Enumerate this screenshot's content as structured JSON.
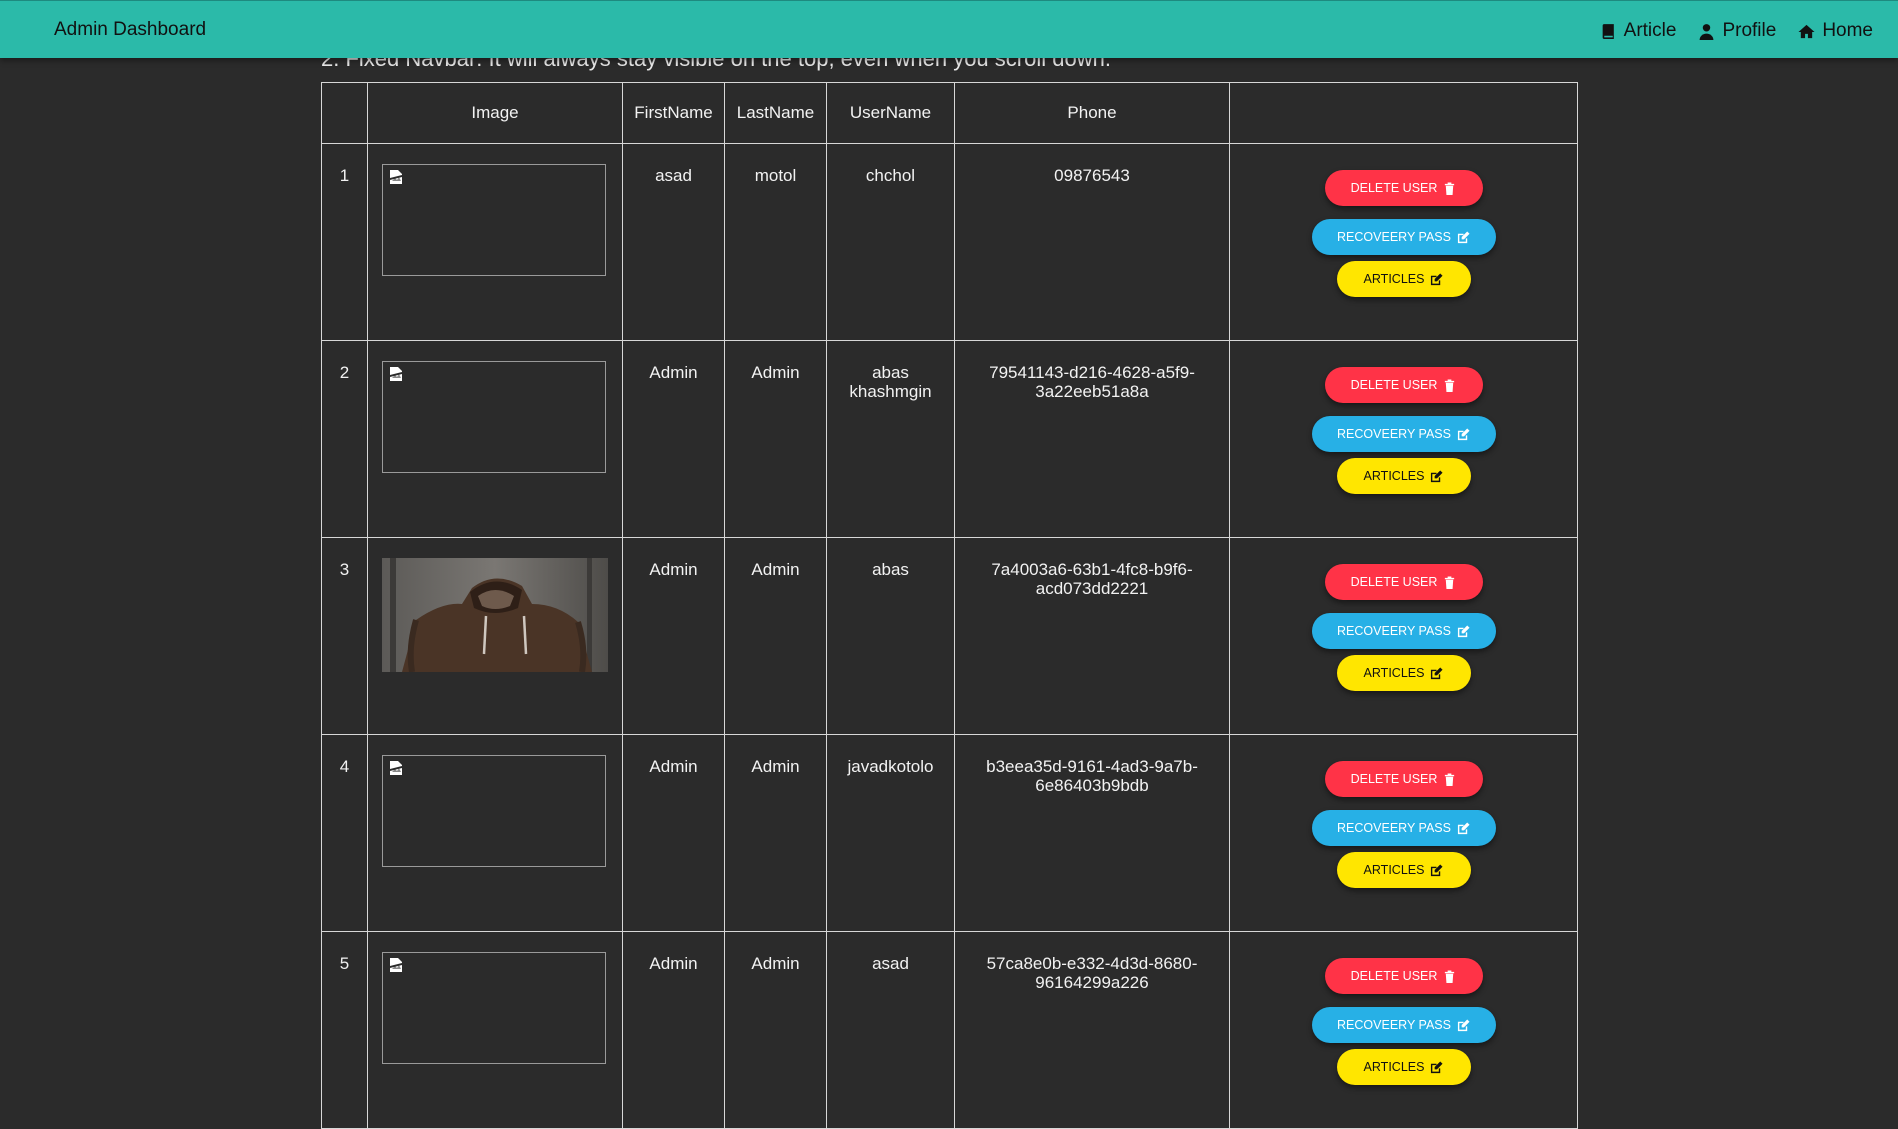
{
  "navbar": {
    "brand": "Admin Dashboard",
    "links": [
      {
        "label": "Article",
        "icon": "book-icon"
      },
      {
        "label": "Profile",
        "icon": "user-icon"
      },
      {
        "label": "Home",
        "icon": "home-icon"
      }
    ]
  },
  "intro_text": "2. Fixed Navbar: It will always stay visible on the top, even when you scroll down.",
  "table": {
    "headers": [
      "",
      "Image",
      "FirstName",
      "LastName",
      "UserName",
      "Phone",
      ""
    ],
    "rows": [
      {
        "index": "1",
        "first": "asad",
        "last": "motol",
        "username": "chchol",
        "phone": "09876543",
        "image": "broken-image"
      },
      {
        "index": "2",
        "first": "Admin",
        "last": "Admin",
        "username": "abas khashmgin",
        "phone": "79541143-d216-4628-a5f9-3a22eeb51a8a",
        "image": "broken-image"
      },
      {
        "index": "3",
        "first": "Admin",
        "last": "Admin",
        "username": "abas",
        "phone": "7a4003a6-63b1-4fc8-b9f6-acd073dd2221",
        "image": "photo-hooded-person"
      },
      {
        "index": "4",
        "first": "Admin",
        "last": "Admin",
        "username": "javadkotolo",
        "phone": "b3eea35d-9161-4ad3-9a7b-6e86403b9bdb",
        "image": "broken-image"
      },
      {
        "index": "5",
        "first": "Admin",
        "last": "Admin",
        "username": "asad",
        "phone": "57ca8e0b-e332-4d3d-8680-96164299a226",
        "image": "broken-image"
      }
    ]
  },
  "actions": {
    "delete_label": "DELETE USER",
    "recover_label": "RECOVEERY PASS",
    "articles_label": "ARTICLES"
  },
  "colors": {
    "navbar": "#2bbaa9",
    "background": "#2b2b2b",
    "delete": "#ff3347",
    "recover": "#27b0e6",
    "articles": "#ffe600"
  }
}
